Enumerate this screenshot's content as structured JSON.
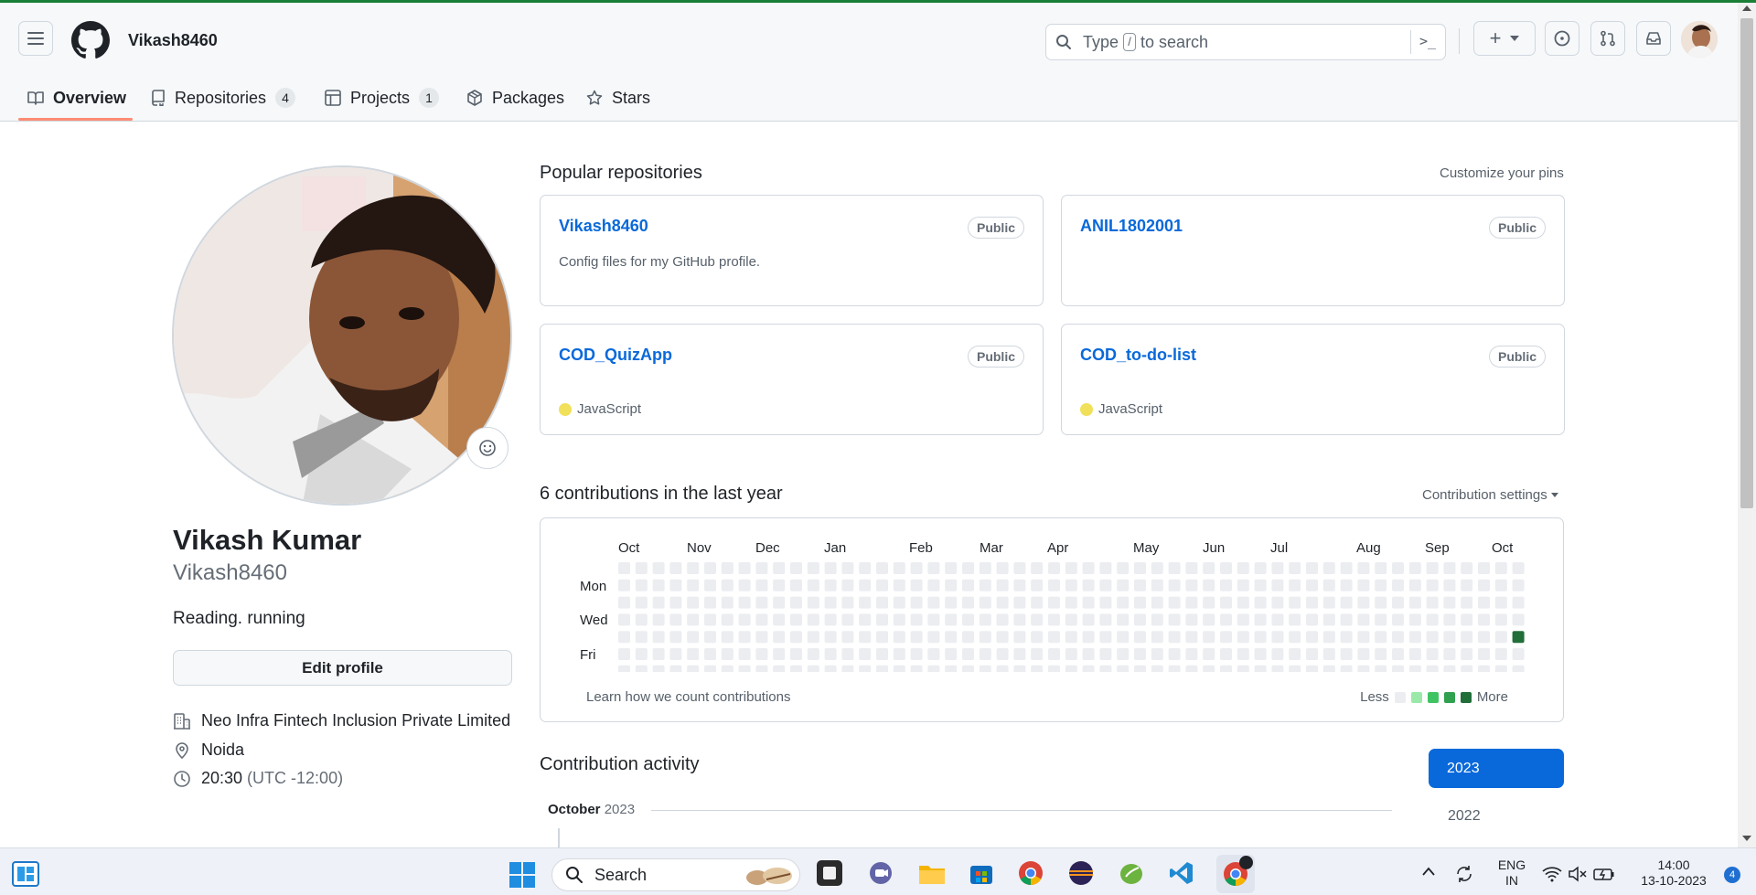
{
  "header": {
    "username": "Vikash8460",
    "search_placeholder_before": "Type",
    "search_slash": "/",
    "search_placeholder_after": "to search",
    "search_prompt_glyph": ">_",
    "create_glyph": "+"
  },
  "tabs": [
    {
      "label": "Overview",
      "icon": "book-icon",
      "active": true
    },
    {
      "label": "Repositories",
      "icon": "repo-icon",
      "count": "4"
    },
    {
      "label": "Projects",
      "icon": "table-icon",
      "count": "1"
    },
    {
      "label": "Packages",
      "icon": "package-icon"
    },
    {
      "label": "Stars",
      "icon": "star-icon"
    }
  ],
  "profile": {
    "name": "Vikash Kumar",
    "login": "Vikash8460",
    "bio": "Reading. running",
    "edit_label": "Edit profile",
    "company": "Neo Infra Fintech Inclusion Private Limited",
    "location": "Noida",
    "time": "20:30",
    "timezone": "(UTC -12:00)"
  },
  "popular": {
    "title": "Popular repositories",
    "customize": "Customize your pins",
    "repos": [
      {
        "name": "Vikash8460",
        "visibility": "Public",
        "description": "Config files for my GitHub profile.",
        "language": ""
      },
      {
        "name": "ANIL1802001",
        "visibility": "Public",
        "description": "",
        "language": ""
      },
      {
        "name": "COD_QuizApp",
        "visibility": "Public",
        "description": "",
        "language": "JavaScript",
        "lang_color": "#f1e05a"
      },
      {
        "name": "COD_to-do-list",
        "visibility": "Public",
        "description": "",
        "language": "JavaScript",
        "lang_color": "#f1e05a"
      }
    ]
  },
  "contributions": {
    "title": "6 contributions in the last year",
    "settings": "Contribution settings",
    "months": [
      "Oct",
      "Nov",
      "Dec",
      "Jan",
      "Feb",
      "Mar",
      "Apr",
      "May",
      "Jun",
      "Jul",
      "Aug",
      "Sep",
      "Oct"
    ],
    "days": [
      "Mon",
      "Wed",
      "Fri"
    ],
    "learn": "Learn how we count contributions",
    "legend_less": "Less",
    "legend_more": "More",
    "weeks": 53,
    "active_cell": {
      "week": 52,
      "day": 4,
      "level": 4
    },
    "colors": {
      "empty": "#ebedf0",
      "l1": "#9be9a8",
      "l2": "#40c463",
      "l3": "#30a14e",
      "l4": "#216e39"
    }
  },
  "activity": {
    "title": "Contribution activity",
    "month": "October",
    "year": "2023",
    "years": [
      "2023",
      "2022"
    ]
  },
  "taskbar": {
    "search": "Search",
    "lang_top": "ENG",
    "lang_bottom": "IN",
    "time": "14:00",
    "date": "13-10-2023",
    "notif_count": "4"
  }
}
